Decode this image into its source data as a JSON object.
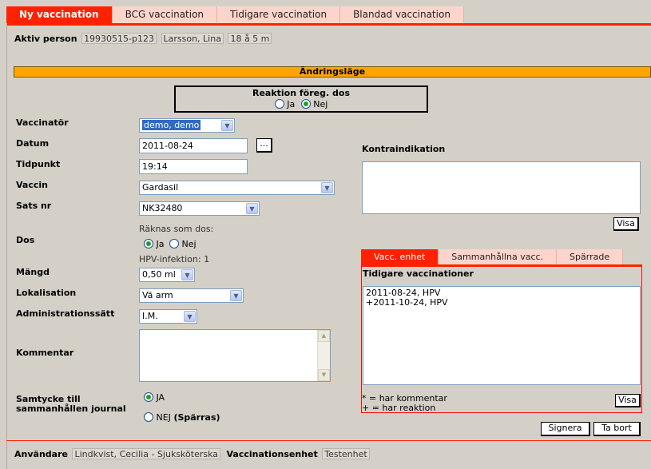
{
  "tabs": [
    "Ny vaccination",
    "BCG vaccination",
    "Tidigare vaccination",
    "Blandad vaccination"
  ],
  "person": {
    "label": "Aktiv person",
    "id": "19930515-p123",
    "name": "Larsson, Lina",
    "age": "18 å 5 m"
  },
  "mode_banner": "Ändringsläge",
  "reaktion": {
    "title": "Reaktion föreg. dos",
    "ja": "Ja",
    "nej": "Nej",
    "selected": "Nej"
  },
  "form": {
    "vaccinator_label": "Vaccinatör",
    "vaccinator_value": "demo, demo",
    "datum_label": "Datum",
    "datum_value": "2011-08-24",
    "datum_button": "...",
    "tidpunkt_label": "Tidpunkt",
    "tidpunkt_value": "19:14",
    "vaccin_label": "Vaccin",
    "vaccin_value": "Gardasil",
    "sats_label": "Sats nr",
    "sats_value": "NK32480",
    "dos_label": "Dos",
    "raknas_label": "Räknas som dos:",
    "dos_ja": "Ja",
    "dos_nej": "Nej",
    "hpv_info": "HPV-infektion: 1",
    "mangd_label": "Mängd",
    "mangd_value": "0,50 ml",
    "lokalisation_label": "Lokalisation",
    "lokalisation_value": "Vä arm",
    "admin_label": "Administrationssätt",
    "admin_value": "I.M.",
    "kommentar_label": "Kommentar",
    "samtycke_label_1": "Samtycke till",
    "samtycke_label_2": "sammanhållen journal",
    "samtycke_ja": "JA",
    "samtycke_nej": "NEJ",
    "samtycke_nej_suffix": "(Spärras)"
  },
  "kontraindikation": {
    "label": "Kontraindikation",
    "visa": "Visa"
  },
  "subtabs": [
    "Vacc. enhet",
    "Sammanhållna vacc.",
    "Spärrade"
  ],
  "tidigare": {
    "title": "Tidigare vaccinationer",
    "entries": [
      "2011-08-24, HPV",
      "+2011-10-24, HPV"
    ],
    "legend_1": "* = har kommentar",
    "legend_2": "+ = har reaktion",
    "visa": "Visa"
  },
  "actions": {
    "signera": "Signera",
    "ta_bort": "Ta bort"
  },
  "footer": {
    "anvandare_label": "Användare",
    "anvandare_value": "Lindkvist, Cecilia - Sjuksköterska",
    "enhet_label": "Vaccinationsenhet",
    "enhet_value": "Testenhet"
  }
}
